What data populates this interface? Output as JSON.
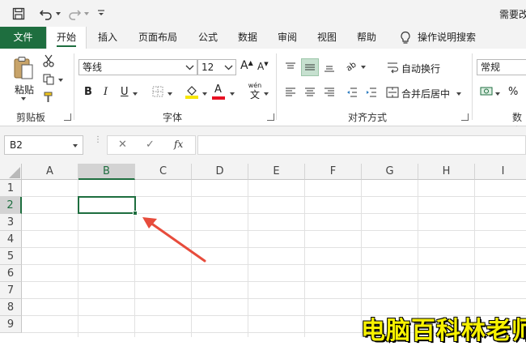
{
  "title_bar": {
    "doc_title": "需要改"
  },
  "tabs": {
    "file": "文件",
    "home": "开始",
    "insert": "插入",
    "page_layout": "页面布局",
    "formulas": "公式",
    "data": "数据",
    "review": "审阅",
    "view": "视图",
    "help": "帮助",
    "tell_me": "操作说明搜索"
  },
  "clipboard": {
    "paste_label": "粘贴",
    "group_label": "剪贴板"
  },
  "font": {
    "name": "等线",
    "size": "12",
    "bold": "B",
    "italic": "I",
    "underline": "U",
    "wen": "wén",
    "wen_char": "文",
    "grow": "A",
    "shrink": "A",
    "font_color_glyph": "A",
    "group_label": "字体",
    "font_color": "#e81123",
    "fill_color": "#f7e600"
  },
  "alignment": {
    "wrap_text": "自动换行",
    "merge_center": "合并后居中",
    "group_label": "对齐方式",
    "orientation_glyph": "ab"
  },
  "number": {
    "format": "常规",
    "percent": "%",
    "group_label": "数字"
  },
  "formula_bar": {
    "name_box": "B2",
    "fx": "fx",
    "cancel": "✕",
    "confirm": "✓"
  },
  "grid": {
    "columns": [
      "A",
      "B",
      "C",
      "D",
      "E",
      "F",
      "G",
      "H",
      "I"
    ],
    "rows": [
      "1",
      "2",
      "3",
      "4",
      "5",
      "6",
      "7",
      "8",
      "9"
    ],
    "selected_cell": "B2",
    "accent": "#1e6e3f"
  },
  "watermark": {
    "text": "电脑百科林老师"
  }
}
